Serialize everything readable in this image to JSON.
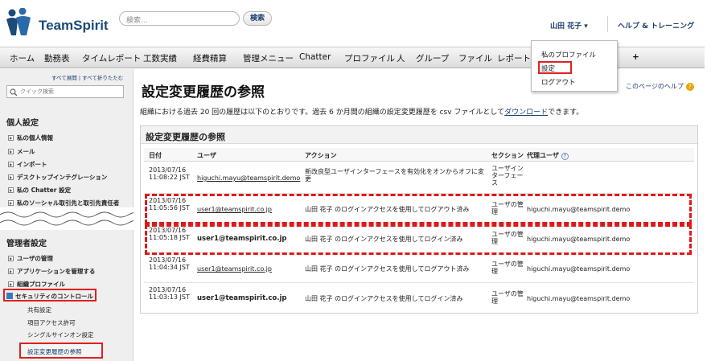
{
  "header": {
    "logo_text": "TeamSpirit",
    "search_placeholder": "検索...",
    "search_button": "検索",
    "user_menu": "山田 花子 ▾",
    "help_link": "ヘルプ & トレーニング"
  },
  "tabs": [
    "ホーム",
    "勤務表",
    "タイムレポート",
    "工数実績",
    "経費精算",
    "管理メニュー",
    "Chatter",
    "プロファイル",
    "人",
    "グループ",
    "ファイル",
    "レポート",
    "…",
    "ボ",
    "議",
    "+"
  ],
  "user_dropdown": [
    "私のプロファイル",
    "設定",
    "ログアウト"
  ],
  "sidebar": {
    "expand_collapse": "すべて展開 | すべて折りたたむ",
    "search_placeholder": "クイック検索",
    "personal_heading": "個人設定",
    "personal_items": [
      "私の個人情報",
      "メール",
      "インポート",
      "デスクトップインテグレーション",
      "私の Chatter 設定",
      "私のソーシャル取引先と取引先責任者"
    ],
    "admin_heading": "管理者設定",
    "admin_items": [
      "ユーザの管理",
      "アプリケーションを管理する",
      "組織プロファイル",
      "セキュリティのコントロール"
    ],
    "security_subitems": [
      "共有設定",
      "項目アクセス許可",
      "シングルサインオン設定",
      "設定変更履歴の参照"
    ]
  },
  "main": {
    "title": "設定変更履歴の参照",
    "page_help": "このページのヘルプ",
    "description_before": "組織における過去 20 回の履歴は以下のとおりです。過去 6 か月間の組織の設定変更履歴を csv ファイルとして",
    "description_link": "ダウンロード",
    "description_after": "できます。",
    "panel_title": "設定変更履歴の参照",
    "columns": [
      "日付",
      "ユーザ",
      "アクション",
      "セクション",
      "代理ユーザ"
    ],
    "rows": [
      {
        "date": "2013/07/16 11:08:22 JST",
        "user": "higuchi.mayu@teamspirit.demo",
        "action": "新改良型ユーザインターフェースを有効化をオンからオフに変更",
        "section": "ユーザインターフェース",
        "delegate": ""
      },
      {
        "date": "2013/07/16 11:05:56 JST",
        "user": "user1@teamspirit.co.jp",
        "action": "山田 花子 のログインアクセスを使用してログアウト済み",
        "section": "ユーザの管理",
        "delegate": "higuchi.mayu@teamspirit.demo"
      },
      {
        "date": "2013/07/16 11:05:18 JST",
        "user": "user1@teamspirit.co.jp",
        "action": "山田 花子 のログインアクセスを使用してログイン済み",
        "section": "ユーザの管理",
        "delegate": "higuchi.mayu@teamspirit.demo"
      },
      {
        "date": "2013/07/16 11:04:34 JST",
        "user": "user1@teamspirit.co.jp",
        "action": "山田 花子 のログインアクセスを使用してログアウト済み",
        "section": "ユーザの管理",
        "delegate": "higuchi.mayu@teamspirit.demo"
      },
      {
        "date": "2013/07/16 11:03:13 JST",
        "user": "user1@teamspirit.co.jp",
        "action": "山田 花子 のログインアクセスを使用してログイン済み",
        "section": "ユーザの管理",
        "delegate": "higuchi.mayu@teamspirit.demo"
      }
    ]
  },
  "colors": {
    "highlight": "#e01818",
    "brand": "#1a4a7a",
    "link": "#1a3c6e"
  }
}
